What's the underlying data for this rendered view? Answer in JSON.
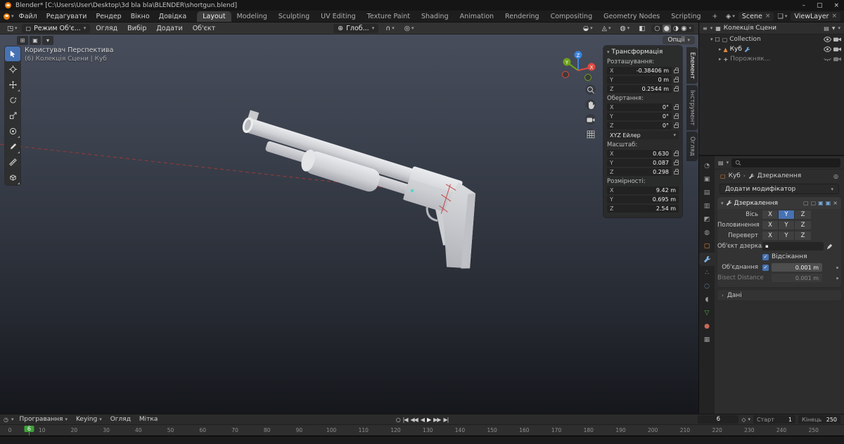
{
  "titlebar": {
    "title": "Blender* [C:\\Users\\User\\Desktop\\3d bla bla\\BLENDER\\shortgun.blend]"
  },
  "menubar": {
    "menus": [
      "Файл",
      "Редагувати",
      "Рендер",
      "Вікно",
      "Довідка"
    ],
    "workspaces": [
      "Layout",
      "Modeling",
      "Sculpting",
      "UV Editing",
      "Texture Paint",
      "Shading",
      "Animation",
      "Rendering",
      "Compositing",
      "Geometry Nodes",
      "Scripting",
      "+"
    ],
    "scene_label": "Scene",
    "viewlayer_label": "ViewLayer"
  },
  "header": {
    "mode_label": "Режим Об'є...",
    "menus": [
      "Огляд",
      "Вибір",
      "Додати",
      "Об'єкт"
    ],
    "orientation_label": "Глоб...",
    "options_label": "Опції"
  },
  "viewport": {
    "view_label": "Користувач Перспектива",
    "context_label": "(6) Колекція Сцени | Куб",
    "npanel": {
      "title": "Трансформація",
      "location_label": "Розташування:",
      "rows_location": [
        {
          "axis": "X",
          "value": "-0.38406 m"
        },
        {
          "axis": "Y",
          "value": "0 m"
        },
        {
          "axis": "Z",
          "value": "0.2544 m"
        }
      ],
      "rotation_label": "Обертання:",
      "rows_rotation": [
        {
          "axis": "X",
          "value": "0°"
        },
        {
          "axis": "Y",
          "value": "0°"
        },
        {
          "axis": "Z",
          "value": "0°"
        }
      ],
      "rotation_mode": "XYZ Ейлер",
      "scale_label": "Масштаб:",
      "rows_scale": [
        {
          "axis": "X",
          "value": "0.630"
        },
        {
          "axis": "Y",
          "value": "0.087"
        },
        {
          "axis": "Z",
          "value": "0.298"
        }
      ],
      "dimensions_label": "Розмірності:",
      "rows_dimensions": [
        {
          "axis": "X",
          "value": "9.42 m"
        },
        {
          "axis": "Y",
          "value": "0.695 m"
        },
        {
          "axis": "Z",
          "value": "2.54 m"
        }
      ],
      "tabs": [
        "Елемент",
        "Інструмент",
        "Огляд"
      ]
    }
  },
  "outliner": {
    "root_label": "Колекція Сцени",
    "rows": [
      {
        "label": "Collection"
      },
      {
        "label": "Куб"
      },
      {
        "label": "Порожняк..."
      }
    ]
  },
  "properties": {
    "breadcrumb": {
      "object": "Куб",
      "modifier": "Дзеркалення"
    },
    "add_button": "Додати модифікатор",
    "modifier": {
      "name": "Дзеркалення",
      "axis_label": "Вісь",
      "bisect_label": "Половинення",
      "flip_label": "Переверт",
      "axes": [
        "X",
        "Y",
        "Z"
      ],
      "mirror_object_label": "Об'єкт дзеркал...",
      "clipping_label": "Відсікання",
      "merge_label": "Об'єднання",
      "merge_value": "0.001 m",
      "bisect_distance_label": "Bisect Distance",
      "bisect_distance_value": "0.001 m",
      "data_label": "Дані"
    }
  },
  "timeline": {
    "menus": [
      "Програвання",
      "Keying",
      "Огляд",
      "Мітка"
    ],
    "current_frame": "6",
    "start_label": "Старт",
    "start_value": "1",
    "end_label": "Кінець",
    "end_value": "250",
    "ticks": [
      0,
      10,
      20,
      30,
      40,
      50,
      60,
      70,
      80,
      90,
      100,
      110,
      120,
      130,
      140,
      150,
      160,
      170,
      180,
      190,
      200,
      210,
      220,
      230,
      240,
      250
    ]
  }
}
